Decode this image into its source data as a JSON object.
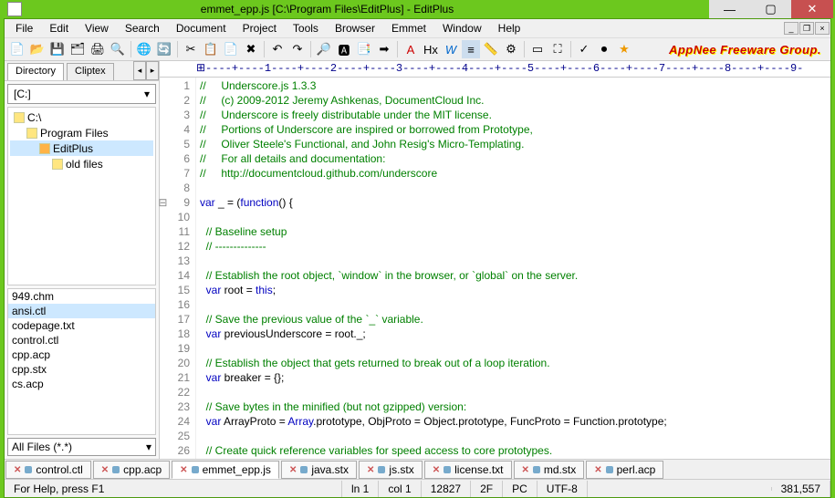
{
  "window": {
    "title": "emmet_epp.js [C:\\Program Files\\EditPlus] - EditPlus"
  },
  "menu": {
    "items": [
      "File",
      "Edit",
      "View",
      "Search",
      "Document",
      "Project",
      "Tools",
      "Browser",
      "Emmet",
      "Window",
      "Help"
    ]
  },
  "logo": "AppNee Freeware Group.",
  "sidebar": {
    "tabs": {
      "dir": "Directory",
      "clip": "Cliptex"
    },
    "drive": "[C:]",
    "tree": [
      {
        "label": "C:\\",
        "indent": 0
      },
      {
        "label": "Program Files",
        "indent": 1
      },
      {
        "label": "EditPlus",
        "indent": 2,
        "sel": true
      },
      {
        "label": "old files",
        "indent": 3
      }
    ],
    "files": [
      "949.chm",
      "ansi.ctl",
      "codepage.txt",
      "control.ctl",
      "cpp.acp",
      "cpp.stx",
      "cs.acp"
    ],
    "filter": "All Files (*.*)"
  },
  "ruler": "⊞----+----1----+----2----+----3----+----4----+----5----+----6----+----7----+----8----+----9-",
  "code": [
    {
      "n": 1,
      "t": "//     Underscore.js 1.3.3",
      "c": "cmt"
    },
    {
      "n": 2,
      "t": "//     (c) 2009-2012 Jeremy Ashkenas, DocumentCloud Inc.",
      "c": "cmt"
    },
    {
      "n": 3,
      "t": "//     Underscore is freely distributable under the MIT license.",
      "c": "cmt"
    },
    {
      "n": 4,
      "t": "//     Portions of Underscore are inspired or borrowed from Prototype,",
      "c": "cmt"
    },
    {
      "n": 5,
      "t": "//     Oliver Steele's Functional, and John Resig's Micro-Templating.",
      "c": "cmt"
    },
    {
      "n": 6,
      "t": "//     For all details and documentation:",
      "c": "cmt"
    },
    {
      "n": 7,
      "t": "//     http://documentcloud.github.com/underscore",
      "c": "cmt"
    },
    {
      "n": 8,
      "t": "",
      "c": ""
    },
    {
      "n": 9,
      "html": "<span class='kw'>var</span> _ = (<span class='kw'>function</span>() {",
      "fold": true
    },
    {
      "n": 10,
      "t": "",
      "c": ""
    },
    {
      "n": 11,
      "t": "  // Baseline setup",
      "c": "cmt"
    },
    {
      "n": 12,
      "t": "  // --------------",
      "c": "cmt"
    },
    {
      "n": 13,
      "t": "",
      "c": ""
    },
    {
      "n": 14,
      "t": "  // Establish the root object, `window` in the browser, or `global` on the server.",
      "c": "cmt"
    },
    {
      "n": 15,
      "html": "  <span class='kw'>var</span> root = <span class='kw'>this</span>;"
    },
    {
      "n": 16,
      "t": "",
      "c": ""
    },
    {
      "n": 17,
      "t": "  // Save the previous value of the `_` variable.",
      "c": "cmt"
    },
    {
      "n": 18,
      "html": "  <span class='kw'>var</span> previousUnderscore = root._;"
    },
    {
      "n": 19,
      "t": "",
      "c": ""
    },
    {
      "n": 20,
      "t": "  // Establish the object that gets returned to break out of a loop iteration.",
      "c": "cmt"
    },
    {
      "n": 21,
      "html": "  <span class='kw'>var</span> breaker = {};"
    },
    {
      "n": 22,
      "t": "",
      "c": ""
    },
    {
      "n": 23,
      "t": "  // Save bytes in the minified (but not gzipped) version:",
      "c": "cmt"
    },
    {
      "n": 24,
      "html": "  <span class='kw'>var</span> ArrayProto = <span class='kw'>Array</span>.prototype, ObjProto = Object.prototype, FuncProto = Function.prototype;"
    },
    {
      "n": 25,
      "t": "",
      "c": ""
    },
    {
      "n": 26,
      "t": "  // Create quick reference variables for speed access to core prototypes.",
      "c": "cmt"
    }
  ],
  "doctabs": [
    "control.ctl",
    "cpp.acp",
    "emmet_epp.js",
    "java.stx",
    "js.stx",
    "license.txt",
    "md.stx",
    "perl.acp"
  ],
  "doctab_active": 2,
  "status": {
    "help": "For Help, press F1",
    "ln": "ln 1",
    "col": "col 1",
    "chars": "12827",
    "hex": "2F",
    "mode": "PC",
    "enc": "UTF-8",
    "size": "381,557"
  }
}
